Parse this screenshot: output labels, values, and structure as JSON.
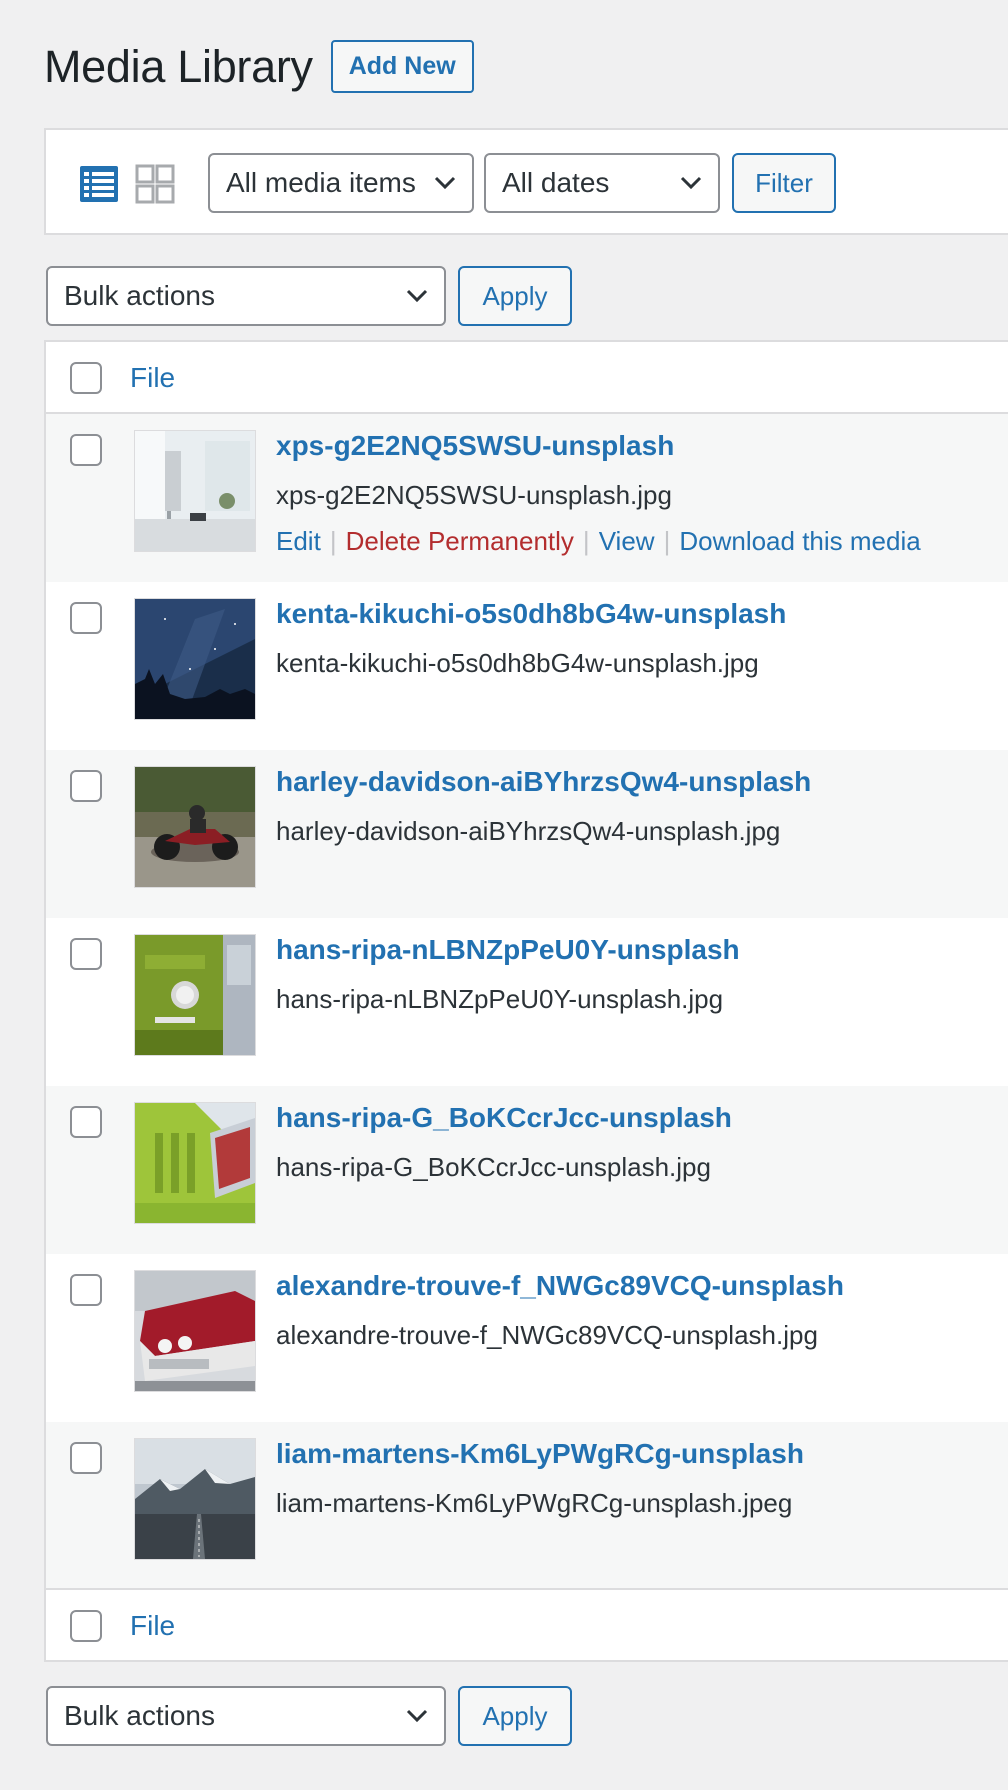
{
  "header": {
    "title": "Media Library",
    "add_new": "Add New"
  },
  "filter_bar": {
    "view_modes": [
      "list-view-icon",
      "grid-view-icon"
    ],
    "active_view": "list",
    "media_type": "All media items",
    "dates": "All dates",
    "filter_label": "Filter"
  },
  "bulk": {
    "label": "Bulk actions",
    "apply": "Apply"
  },
  "table": {
    "column_file": "File",
    "rows": [
      {
        "title": "xps-g2E2NQ5SWSU-unsplash",
        "filename": "xps-g2E2NQ5SWSU-unsplash.jpg",
        "actions": {
          "edit": "Edit",
          "delete": "Delete Permanently",
          "view": "View",
          "download": "Download this media"
        }
      },
      {
        "title": "kenta-kikuchi-o5s0dh8bG4w-unsplash",
        "filename": "kenta-kikuchi-o5s0dh8bG4w-unsplash.jpg"
      },
      {
        "title": "harley-davidson-aiBYhrzsQw4-unsplash",
        "filename": "harley-davidson-aiBYhrzsQw4-unsplash.jpg"
      },
      {
        "title": "hans-ripa-nLBNZpPeU0Y-unsplash",
        "filename": "hans-ripa-nLBNZpPeU0Y-unsplash.jpg"
      },
      {
        "title": "hans-ripa-G_BoKCcrJcc-unsplash",
        "filename": "hans-ripa-G_BoKCcrJcc-unsplash.jpg"
      },
      {
        "title": "alexandre-trouve-f_NWGc89VCQ-unsplash",
        "filename": "alexandre-trouve-f_NWGc89VCQ-unsplash.jpg"
      },
      {
        "title": "liam-martens-Km6LyPWgRCg-unsplash",
        "filename": "liam-martens-Km6LyPWgRCg-unsplash.jpeg"
      }
    ]
  },
  "colors": {
    "link": "#2271b1",
    "delete": "#b32d2e",
    "background": "#f0f0f1"
  }
}
